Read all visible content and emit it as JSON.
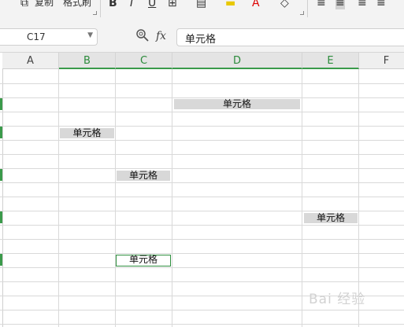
{
  "ribbon": {
    "copy_label": "复制",
    "format_painter_label": "格式刷",
    "bold_icon": "B",
    "italic_icon": "I",
    "underline_icon": "U",
    "font_color_icon": "A"
  },
  "namebox": {
    "value": "C17"
  },
  "formula": {
    "fx_label": "fx",
    "value": "单元格"
  },
  "columns": [
    "A",
    "B",
    "C",
    "D",
    "E",
    "F"
  ],
  "selected_columns": [
    "B",
    "C",
    "D",
    "E"
  ],
  "cells": [
    {
      "col": "D",
      "text": "单元格"
    },
    {
      "col": "B",
      "text": "单元格"
    },
    {
      "col": "C",
      "text": "单元格"
    },
    {
      "col": "E",
      "text": "单元格"
    },
    {
      "col": "C",
      "text": "单元格",
      "active": true
    }
  ],
  "watermark": "Bai 经验",
  "colors": {
    "accent": "#3a9a4a",
    "cell_fill": "#d8d8d8"
  }
}
